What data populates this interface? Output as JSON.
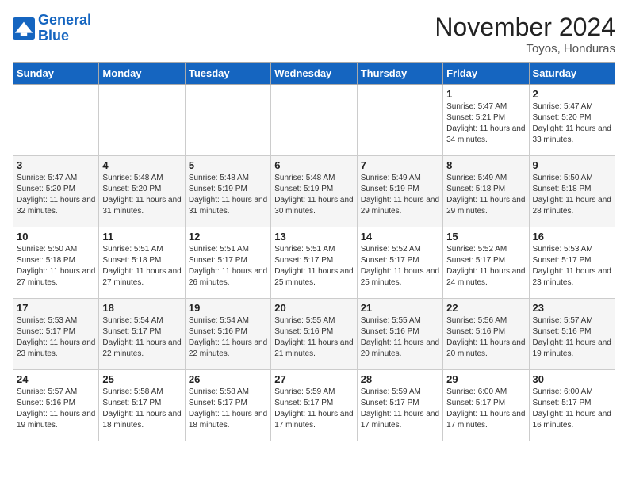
{
  "header": {
    "logo_line1": "General",
    "logo_line2": "Blue",
    "month": "November 2024",
    "location": "Toyos, Honduras"
  },
  "days_of_week": [
    "Sunday",
    "Monday",
    "Tuesday",
    "Wednesday",
    "Thursday",
    "Friday",
    "Saturday"
  ],
  "weeks": [
    [
      {
        "day": "",
        "info": ""
      },
      {
        "day": "",
        "info": ""
      },
      {
        "day": "",
        "info": ""
      },
      {
        "day": "",
        "info": ""
      },
      {
        "day": "",
        "info": ""
      },
      {
        "day": "1",
        "info": "Sunrise: 5:47 AM\nSunset: 5:21 PM\nDaylight: 11 hours and 34 minutes."
      },
      {
        "day": "2",
        "info": "Sunrise: 5:47 AM\nSunset: 5:20 PM\nDaylight: 11 hours and 33 minutes."
      }
    ],
    [
      {
        "day": "3",
        "info": "Sunrise: 5:47 AM\nSunset: 5:20 PM\nDaylight: 11 hours and 32 minutes."
      },
      {
        "day": "4",
        "info": "Sunrise: 5:48 AM\nSunset: 5:20 PM\nDaylight: 11 hours and 31 minutes."
      },
      {
        "day": "5",
        "info": "Sunrise: 5:48 AM\nSunset: 5:19 PM\nDaylight: 11 hours and 31 minutes."
      },
      {
        "day": "6",
        "info": "Sunrise: 5:48 AM\nSunset: 5:19 PM\nDaylight: 11 hours and 30 minutes."
      },
      {
        "day": "7",
        "info": "Sunrise: 5:49 AM\nSunset: 5:19 PM\nDaylight: 11 hours and 29 minutes."
      },
      {
        "day": "8",
        "info": "Sunrise: 5:49 AM\nSunset: 5:18 PM\nDaylight: 11 hours and 29 minutes."
      },
      {
        "day": "9",
        "info": "Sunrise: 5:50 AM\nSunset: 5:18 PM\nDaylight: 11 hours and 28 minutes."
      }
    ],
    [
      {
        "day": "10",
        "info": "Sunrise: 5:50 AM\nSunset: 5:18 PM\nDaylight: 11 hours and 27 minutes."
      },
      {
        "day": "11",
        "info": "Sunrise: 5:51 AM\nSunset: 5:18 PM\nDaylight: 11 hours and 27 minutes."
      },
      {
        "day": "12",
        "info": "Sunrise: 5:51 AM\nSunset: 5:17 PM\nDaylight: 11 hours and 26 minutes."
      },
      {
        "day": "13",
        "info": "Sunrise: 5:51 AM\nSunset: 5:17 PM\nDaylight: 11 hours and 25 minutes."
      },
      {
        "day": "14",
        "info": "Sunrise: 5:52 AM\nSunset: 5:17 PM\nDaylight: 11 hours and 25 minutes."
      },
      {
        "day": "15",
        "info": "Sunrise: 5:52 AM\nSunset: 5:17 PM\nDaylight: 11 hours and 24 minutes."
      },
      {
        "day": "16",
        "info": "Sunrise: 5:53 AM\nSunset: 5:17 PM\nDaylight: 11 hours and 23 minutes."
      }
    ],
    [
      {
        "day": "17",
        "info": "Sunrise: 5:53 AM\nSunset: 5:17 PM\nDaylight: 11 hours and 23 minutes."
      },
      {
        "day": "18",
        "info": "Sunrise: 5:54 AM\nSunset: 5:17 PM\nDaylight: 11 hours and 22 minutes."
      },
      {
        "day": "19",
        "info": "Sunrise: 5:54 AM\nSunset: 5:16 PM\nDaylight: 11 hours and 22 minutes."
      },
      {
        "day": "20",
        "info": "Sunrise: 5:55 AM\nSunset: 5:16 PM\nDaylight: 11 hours and 21 minutes."
      },
      {
        "day": "21",
        "info": "Sunrise: 5:55 AM\nSunset: 5:16 PM\nDaylight: 11 hours and 20 minutes."
      },
      {
        "day": "22",
        "info": "Sunrise: 5:56 AM\nSunset: 5:16 PM\nDaylight: 11 hours and 20 minutes."
      },
      {
        "day": "23",
        "info": "Sunrise: 5:57 AM\nSunset: 5:16 PM\nDaylight: 11 hours and 19 minutes."
      }
    ],
    [
      {
        "day": "24",
        "info": "Sunrise: 5:57 AM\nSunset: 5:16 PM\nDaylight: 11 hours and 19 minutes."
      },
      {
        "day": "25",
        "info": "Sunrise: 5:58 AM\nSunset: 5:17 PM\nDaylight: 11 hours and 18 minutes."
      },
      {
        "day": "26",
        "info": "Sunrise: 5:58 AM\nSunset: 5:17 PM\nDaylight: 11 hours and 18 minutes."
      },
      {
        "day": "27",
        "info": "Sunrise: 5:59 AM\nSunset: 5:17 PM\nDaylight: 11 hours and 17 minutes."
      },
      {
        "day": "28",
        "info": "Sunrise: 5:59 AM\nSunset: 5:17 PM\nDaylight: 11 hours and 17 minutes."
      },
      {
        "day": "29",
        "info": "Sunrise: 6:00 AM\nSunset: 5:17 PM\nDaylight: 11 hours and 17 minutes."
      },
      {
        "day": "30",
        "info": "Sunrise: 6:00 AM\nSunset: 5:17 PM\nDaylight: 11 hours and 16 minutes."
      }
    ]
  ]
}
